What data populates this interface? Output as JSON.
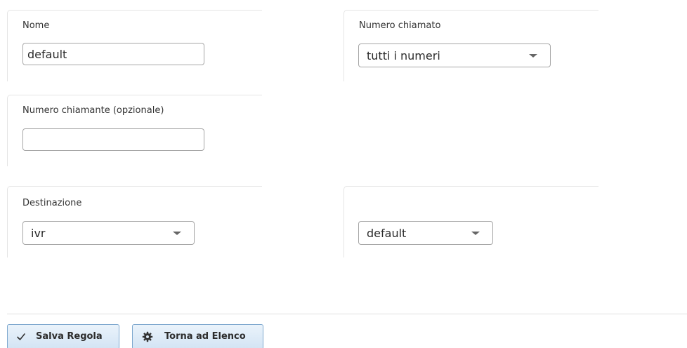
{
  "form": {
    "nome": {
      "label": "Nome",
      "value": "default"
    },
    "numero_chiamato": {
      "label": "Numero chiamato",
      "value": "tutti i numeri"
    },
    "numero_chiamante": {
      "label": "Numero chiamante (opzionale)",
      "value": ""
    },
    "destinazione": {
      "label": "Destinazione",
      "value": "ivr"
    },
    "destinazione_target": {
      "label": "",
      "value": "default"
    }
  },
  "actions": {
    "save_label": "Salva Regola",
    "back_label": "Torna ad Elenco"
  },
  "icons": {
    "save": "check-icon",
    "back": "gear-icon"
  },
  "colors": {
    "button_border": "#7fa9cf",
    "button_bg_top": "#eaf3fb",
    "button_bg_bottom": "#d3e4f4",
    "field_border": "#a6a6a6"
  }
}
